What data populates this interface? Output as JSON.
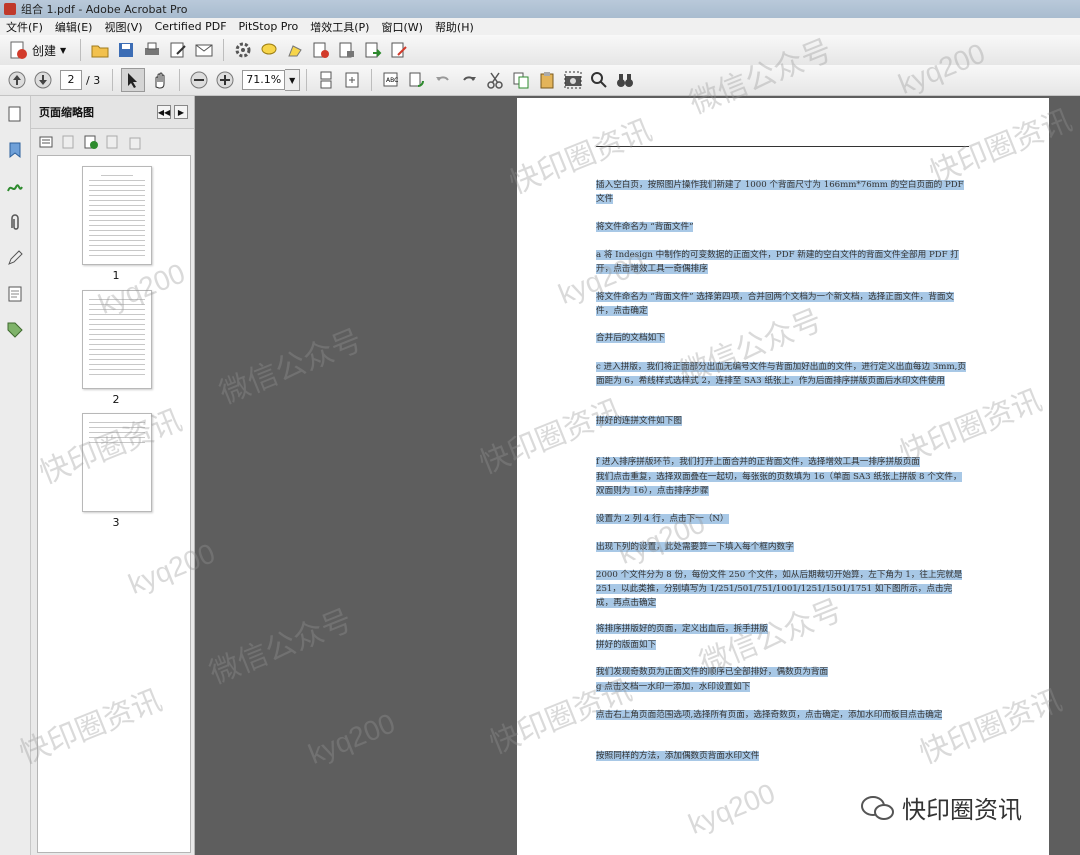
{
  "window": {
    "title": "组合 1.pdf - Adobe Acrobat Pro"
  },
  "menu": [
    "文件(F)",
    "编辑(E)",
    "视图(V)",
    "Certified PDF",
    "PitStop Pro",
    "增效工具(P)",
    "窗口(W)",
    "帮助(H)"
  ],
  "toolbar1": {
    "create_label": "创建"
  },
  "toolbar2": {
    "page_current": "2",
    "page_total": "/ 3",
    "zoom": "71.1%"
  },
  "panel": {
    "title": "页面缩略图",
    "thumbnails": [
      {
        "label": "1"
      },
      {
        "label": "2"
      },
      {
        "label": "3"
      }
    ]
  },
  "document": {
    "paragraphs": [
      "插入空白页，按照图片操作我们新建了 1000 个背面尺寸为 166mm*76mm 的空白页面的 PDF 文件",
      "将文件命名为 “背面文件”",
      "a 将 Indesign 中制作的可变数据的正面文件，PDF 新建的空白文件的背面文件全部用 PDF 打开，点击增效工具一奇偶排序",
      "将文件命名为 “背面文件” 选择第四项，合并回两个文档为一个新文档，选择正面文件，背面文件，点击确定",
      "合并后的文档如下",
      "c 进入拼版，我们将正面部分出血无编号文件与背面加好出血的文件，进行定义出血每边 3mm,页面距为 6，希线样式选样式 2，连排至 SA3 纸张上，作为后面排序拼版页面后水印文件使用",
      "拼好的连拼文件如下图",
      "f 进入排序拼版环节，我们打开上面合并的正背面文件，选择增效工具一排序拼版页面",
      "我们点击重复，选择双面叠在一起切，每张张的页数填为 16（单面 SA3 纸张上拼版 8 个文件，双面则为 16），点击排序步骤",
      "设置为 2 列 4 行，点击下一（N）",
      "出现下列的设置，此处需要算一下填入每个框内数字",
      "2000 个文件分为 8 份，每份文件 250 个文件，如从后期裁切开始算，左下角为 1，往上完就是 251，以此类推，分别填写为 1/251/501/751/1001/1251/1501/1751 如下图所示，点击完成，再点击确定",
      "将排序拼版好的页面，定义出血后，拆手拼版",
      "拼好的版面如下",
      "我们发现奇数页为正面文件的顺序已全部排好，偶数页为背面",
      "g 点击文档一水印一添加，水印设置如下",
      "点击右上角页面范围选项,选择所有页面，选择奇数页，点击确定，添加水印而板目点击确定",
      "按照同样的方法，添加偶数页背面水印文件"
    ]
  },
  "watermarks": [
    "kyq200",
    "微信公众号",
    "快印圈资讯"
  ],
  "logo": {
    "text": "快印圈资讯"
  }
}
